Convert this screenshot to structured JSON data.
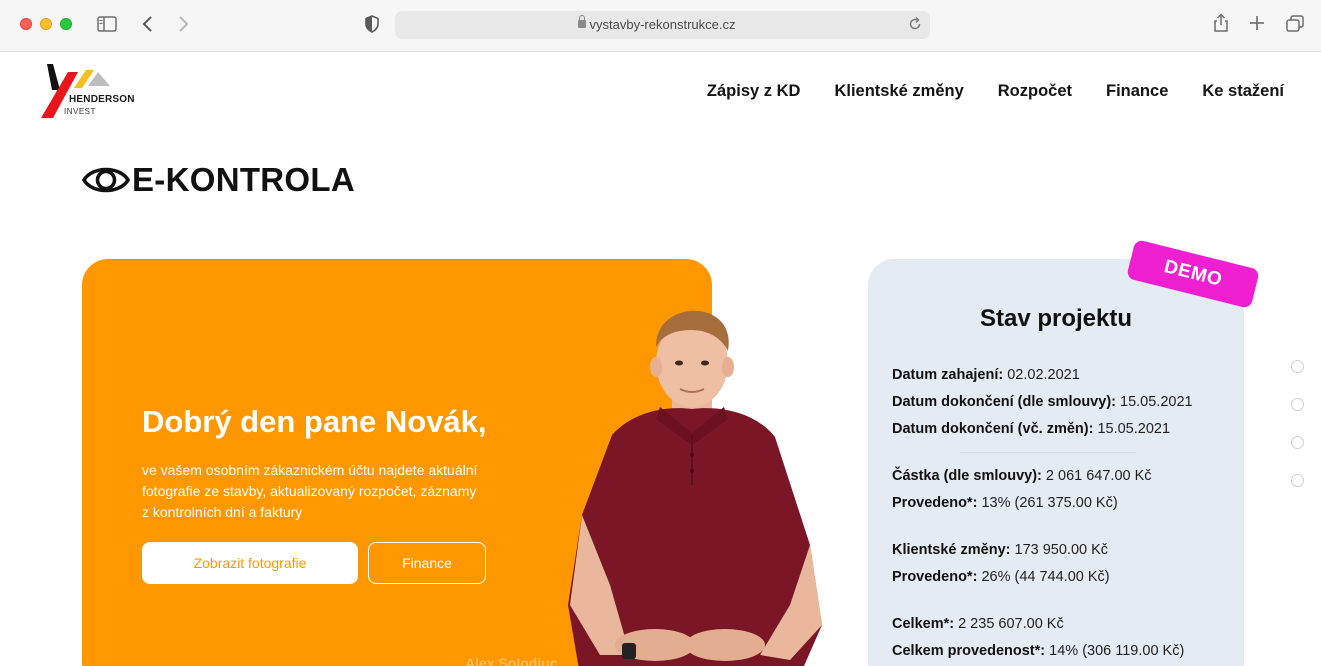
{
  "browser": {
    "url": "vystavby-rekonstrukce.cz"
  },
  "logo": {
    "line1": "HENDERSON",
    "line2": "INVEST"
  },
  "nav": {
    "items": [
      {
        "label": "Zápisy z KD"
      },
      {
        "label": "Klientské změny"
      },
      {
        "label": "Rozpočet"
      },
      {
        "label": "Finance"
      },
      {
        "label": "Ke stažení"
      }
    ]
  },
  "page": {
    "title": "E-KONTROLA"
  },
  "hero": {
    "greeting": "Dobrý den pane Novák,",
    "intro": "ve vašem osobním zákaznickém účtu najdete aktuální fotografie ze stavby, aktualizovaný rozpočet, záznamy z kontrolních dní a faktury",
    "photos_button": "Zobrazit fotografie",
    "finance_button": "Finance",
    "person_name": "Alex Solodiuc",
    "color": "#ff9800"
  },
  "status": {
    "badge": "DEMO",
    "title": "Stav projektu",
    "rows": [
      {
        "label": "Datum zahajení:",
        "value": "02.02.2021"
      },
      {
        "label": "Datum dokončení (dle smlouvy):",
        "value": "15.05.2021"
      },
      {
        "label": "Datum dokončení (vč. změn):",
        "value": "15.05.2021"
      },
      {
        "label": "Částka (dle smlouvy):",
        "value": "2 061 647.00 Kč"
      },
      {
        "label": "Provedeno*:",
        "value": "13% (261 375.00 Kč)"
      },
      {
        "label": "Klientské změny:",
        "value": "173 950.00 Kč"
      },
      {
        "label": "Provedeno*:",
        "value": "26% (44 744.00 Kč)"
      },
      {
        "label": "Celkem*:",
        "value": "2 235 607.00 Kč"
      },
      {
        "label": "Celkem provedenost*:",
        "value": "14% (306 119.00 Kč)"
      }
    ],
    "badge_color": "#f01fd2",
    "card_color": "#e4ebf2"
  }
}
